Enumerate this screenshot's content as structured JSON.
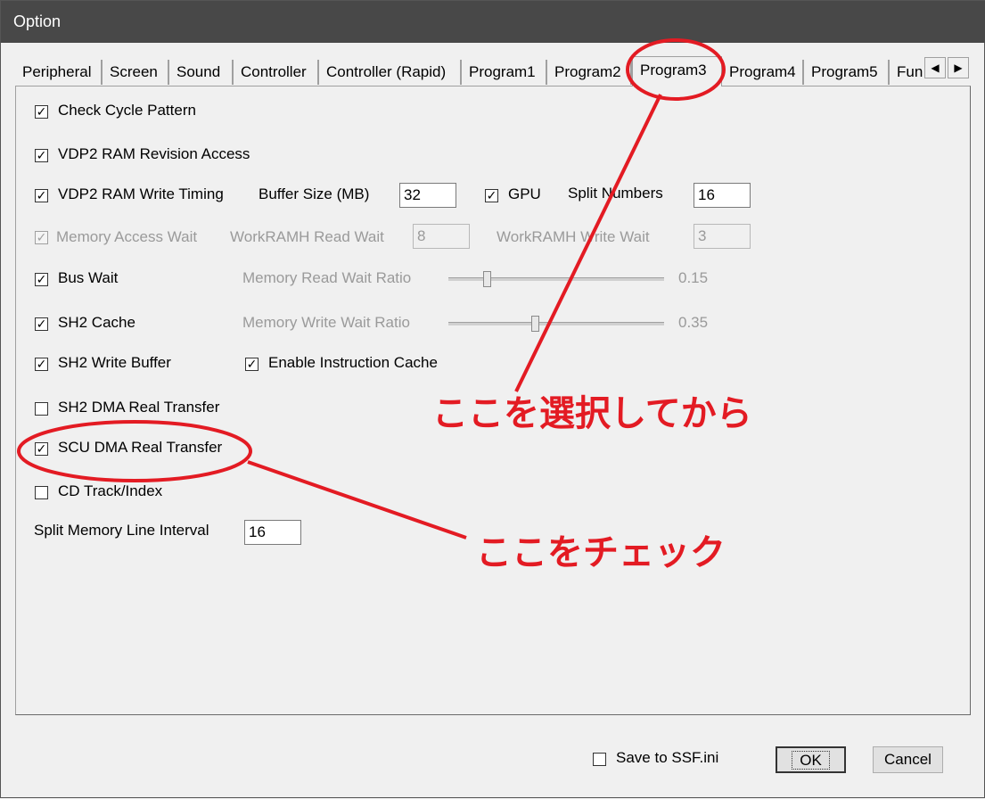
{
  "window": {
    "title": "Option"
  },
  "tabs": [
    {
      "label": "Peripheral"
    },
    {
      "label": "Screen"
    },
    {
      "label": "Sound"
    },
    {
      "label": "Controller"
    },
    {
      "label": "Controller (Rapid)"
    },
    {
      "label": "Program1"
    },
    {
      "label": "Program2"
    },
    {
      "label": "Program3"
    },
    {
      "label": "Program4"
    },
    {
      "label": "Program5"
    },
    {
      "label": "Fun"
    }
  ],
  "active_tab": "Program3",
  "tab_arrows": {
    "left": "◀",
    "right": "▶"
  },
  "options": {
    "check_cycle_pattern": {
      "label": "Check Cycle Pattern",
      "checked": true
    },
    "vdp2_ram_revision_access": {
      "label": "VDP2 RAM Revision Access",
      "checked": true
    },
    "vdp2_ram_write_timing": {
      "label": "VDP2 RAM Write Timing",
      "checked": true
    },
    "buffer_size": {
      "label": "Buffer Size (MB)",
      "value": "32"
    },
    "gpu": {
      "label": "GPU",
      "checked": true
    },
    "split_numbers": {
      "label": "Split Numbers",
      "value": "16"
    },
    "memory_access_wait": {
      "label": "Memory Access Wait",
      "checked": true,
      "disabled": true
    },
    "workramh_read_wait": {
      "label": "WorkRAMH Read Wait",
      "value": "8"
    },
    "workramh_write_wait": {
      "label": "WorkRAMH Write Wait",
      "value": "3"
    },
    "bus_wait": {
      "label": "Bus Wait",
      "checked": true
    },
    "memory_read_wait_ratio": {
      "label": "Memory Read Wait Ratio",
      "value": "0.15",
      "fraction": 0.15
    },
    "sh2_cache": {
      "label": "SH2 Cache",
      "checked": true
    },
    "memory_write_wait_ratio": {
      "label": "Memory Write Wait Ratio",
      "value": "0.35",
      "fraction": 0.35
    },
    "sh2_write_buffer": {
      "label": "SH2 Write Buffer",
      "checked": true
    },
    "enable_instruction_cache": {
      "label": "Enable Instruction Cache",
      "checked": true
    },
    "sh2_dma_real_transfer": {
      "label": "SH2 DMA Real Transfer",
      "checked": false
    },
    "scu_dma_real_transfer": {
      "label": "SCU DMA Real Transfer",
      "checked": true
    },
    "cd_track_index": {
      "label": "CD Track/Index",
      "checked": false
    },
    "split_memory_line_interval": {
      "label": "Split Memory Line Interval",
      "value": "16"
    }
  },
  "footer": {
    "save_to_ini": {
      "label": "Save to SSF.ini",
      "checked": false
    },
    "ok_label": "OK",
    "cancel_label": "Cancel"
  },
  "annotations": {
    "select_here": "ここを選択してから",
    "check_here": "ここをチェック",
    "color": "#e31b23"
  },
  "check_glyph": "✓"
}
